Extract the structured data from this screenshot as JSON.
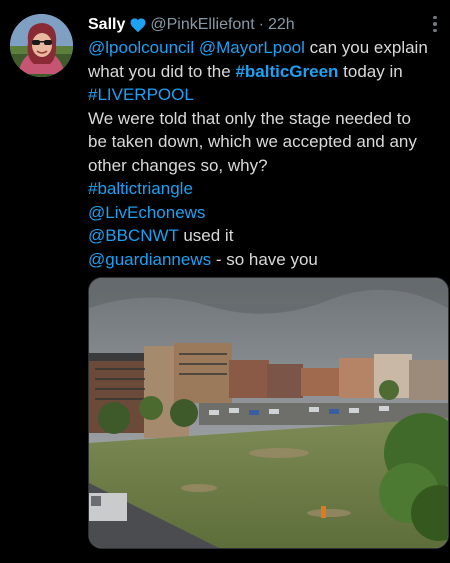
{
  "tweet": {
    "display_name": "Sally",
    "handle": "@PinkElliefont",
    "separator": "·",
    "time": "22h",
    "lines": {
      "l1": {
        "m1": "@lpoolcouncil",
        "m2": "@MayorLpool",
        "rest": " can you explain"
      },
      "l2": {
        "pre": "what you did to the ",
        "tag": "#balticGreen",
        "post": " today in"
      },
      "l3": {
        "tag": "#LIVERPOOL"
      },
      "l4": "We were told that only the stage needed to",
      "l5": "be taken down, which we accepted and any",
      "l6": "other changes so, why?",
      "l7": {
        "tag": "#baltictriangle"
      },
      "l8": {
        "mention": "@LivEchonews"
      },
      "l9": {
        "mention": "@BBCNWT",
        "post": " used it"
      },
      "l10": {
        "mention": "@guardiannews",
        "post": "  - so have you"
      }
    }
  },
  "icons": {
    "verified": "verified-badge-icon",
    "more": "more-options-icon"
  },
  "colors": {
    "background": "#000000",
    "link": "#1da1f2",
    "muted": "#8899a6",
    "text": "#d9d9d9",
    "verified": "#1da1f2"
  }
}
